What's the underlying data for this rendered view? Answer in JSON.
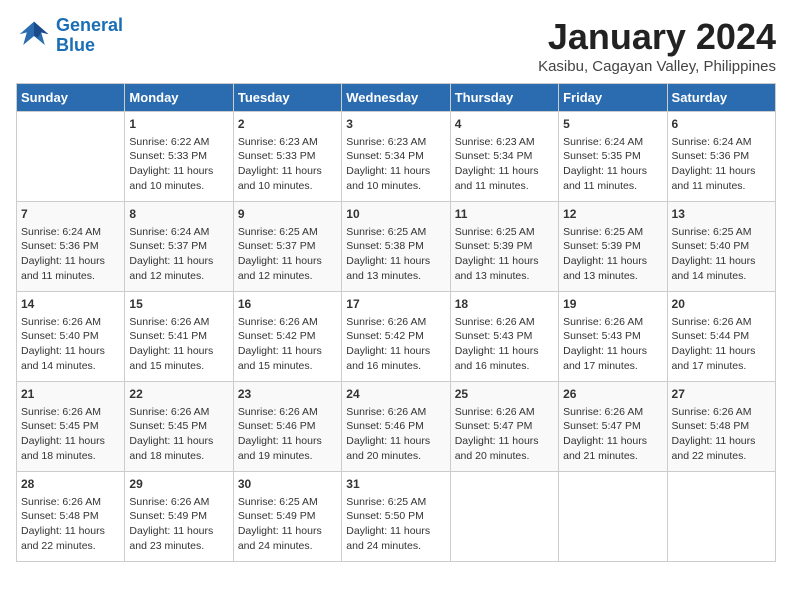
{
  "logo": {
    "line1": "General",
    "line2": "Blue"
  },
  "title": "January 2024",
  "subtitle": "Kasibu, Cagayan Valley, Philippines",
  "headers": [
    "Sunday",
    "Monday",
    "Tuesday",
    "Wednesday",
    "Thursday",
    "Friday",
    "Saturday"
  ],
  "weeks": [
    [
      {
        "day": "",
        "info": ""
      },
      {
        "day": "1",
        "info": "Sunrise: 6:22 AM\nSunset: 5:33 PM\nDaylight: 11 hours\nand 10 minutes."
      },
      {
        "day": "2",
        "info": "Sunrise: 6:23 AM\nSunset: 5:33 PM\nDaylight: 11 hours\nand 10 minutes."
      },
      {
        "day": "3",
        "info": "Sunrise: 6:23 AM\nSunset: 5:34 PM\nDaylight: 11 hours\nand 10 minutes."
      },
      {
        "day": "4",
        "info": "Sunrise: 6:23 AM\nSunset: 5:34 PM\nDaylight: 11 hours\nand 11 minutes."
      },
      {
        "day": "5",
        "info": "Sunrise: 6:24 AM\nSunset: 5:35 PM\nDaylight: 11 hours\nand 11 minutes."
      },
      {
        "day": "6",
        "info": "Sunrise: 6:24 AM\nSunset: 5:36 PM\nDaylight: 11 hours\nand 11 minutes."
      }
    ],
    [
      {
        "day": "7",
        "info": "Sunrise: 6:24 AM\nSunset: 5:36 PM\nDaylight: 11 hours\nand 11 minutes."
      },
      {
        "day": "8",
        "info": "Sunrise: 6:24 AM\nSunset: 5:37 PM\nDaylight: 11 hours\nand 12 minutes."
      },
      {
        "day": "9",
        "info": "Sunrise: 6:25 AM\nSunset: 5:37 PM\nDaylight: 11 hours\nand 12 minutes."
      },
      {
        "day": "10",
        "info": "Sunrise: 6:25 AM\nSunset: 5:38 PM\nDaylight: 11 hours\nand 13 minutes."
      },
      {
        "day": "11",
        "info": "Sunrise: 6:25 AM\nSunset: 5:39 PM\nDaylight: 11 hours\nand 13 minutes."
      },
      {
        "day": "12",
        "info": "Sunrise: 6:25 AM\nSunset: 5:39 PM\nDaylight: 11 hours\nand 13 minutes."
      },
      {
        "day": "13",
        "info": "Sunrise: 6:25 AM\nSunset: 5:40 PM\nDaylight: 11 hours\nand 14 minutes."
      }
    ],
    [
      {
        "day": "14",
        "info": "Sunrise: 6:26 AM\nSunset: 5:40 PM\nDaylight: 11 hours\nand 14 minutes."
      },
      {
        "day": "15",
        "info": "Sunrise: 6:26 AM\nSunset: 5:41 PM\nDaylight: 11 hours\nand 15 minutes."
      },
      {
        "day": "16",
        "info": "Sunrise: 6:26 AM\nSunset: 5:42 PM\nDaylight: 11 hours\nand 15 minutes."
      },
      {
        "day": "17",
        "info": "Sunrise: 6:26 AM\nSunset: 5:42 PM\nDaylight: 11 hours\nand 16 minutes."
      },
      {
        "day": "18",
        "info": "Sunrise: 6:26 AM\nSunset: 5:43 PM\nDaylight: 11 hours\nand 16 minutes."
      },
      {
        "day": "19",
        "info": "Sunrise: 6:26 AM\nSunset: 5:43 PM\nDaylight: 11 hours\nand 17 minutes."
      },
      {
        "day": "20",
        "info": "Sunrise: 6:26 AM\nSunset: 5:44 PM\nDaylight: 11 hours\nand 17 minutes."
      }
    ],
    [
      {
        "day": "21",
        "info": "Sunrise: 6:26 AM\nSunset: 5:45 PM\nDaylight: 11 hours\nand 18 minutes."
      },
      {
        "day": "22",
        "info": "Sunrise: 6:26 AM\nSunset: 5:45 PM\nDaylight: 11 hours\nand 18 minutes."
      },
      {
        "day": "23",
        "info": "Sunrise: 6:26 AM\nSunset: 5:46 PM\nDaylight: 11 hours\nand 19 minutes."
      },
      {
        "day": "24",
        "info": "Sunrise: 6:26 AM\nSunset: 5:46 PM\nDaylight: 11 hours\nand 20 minutes."
      },
      {
        "day": "25",
        "info": "Sunrise: 6:26 AM\nSunset: 5:47 PM\nDaylight: 11 hours\nand 20 minutes."
      },
      {
        "day": "26",
        "info": "Sunrise: 6:26 AM\nSunset: 5:47 PM\nDaylight: 11 hours\nand 21 minutes."
      },
      {
        "day": "27",
        "info": "Sunrise: 6:26 AM\nSunset: 5:48 PM\nDaylight: 11 hours\nand 22 minutes."
      }
    ],
    [
      {
        "day": "28",
        "info": "Sunrise: 6:26 AM\nSunset: 5:48 PM\nDaylight: 11 hours\nand 22 minutes."
      },
      {
        "day": "29",
        "info": "Sunrise: 6:26 AM\nSunset: 5:49 PM\nDaylight: 11 hours\nand 23 minutes."
      },
      {
        "day": "30",
        "info": "Sunrise: 6:25 AM\nSunset: 5:49 PM\nDaylight: 11 hours\nand 24 minutes."
      },
      {
        "day": "31",
        "info": "Sunrise: 6:25 AM\nSunset: 5:50 PM\nDaylight: 11 hours\nand 24 minutes."
      },
      {
        "day": "",
        "info": ""
      },
      {
        "day": "",
        "info": ""
      },
      {
        "day": "",
        "info": ""
      }
    ]
  ]
}
